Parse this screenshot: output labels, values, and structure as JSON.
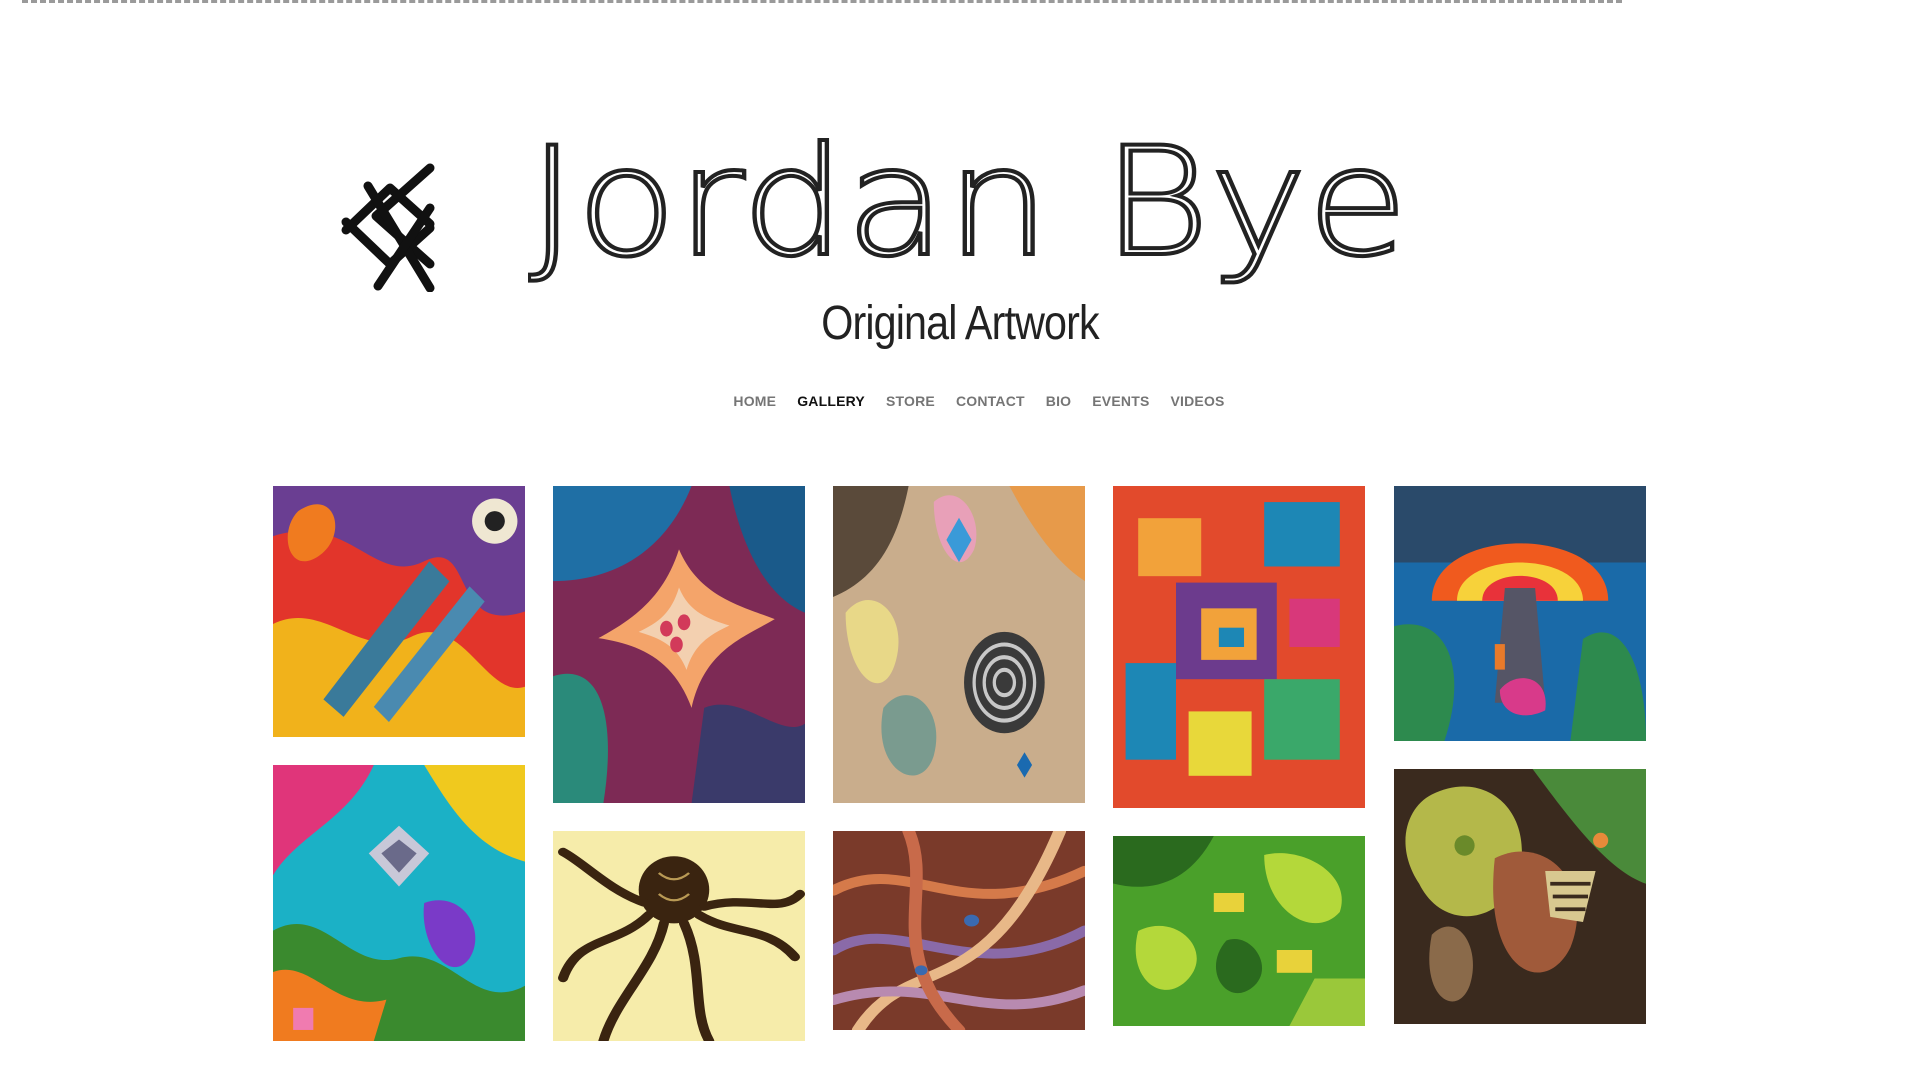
{
  "site": {
    "brand_name": "Jordan Bye",
    "tagline": "Original Artwork"
  },
  "nav": {
    "items": [
      {
        "label": "HOME",
        "active": false
      },
      {
        "label": "GALLERY",
        "active": true
      },
      {
        "label": "STORE",
        "active": false
      },
      {
        "label": "CONTACT",
        "active": false
      },
      {
        "label": "BIO",
        "active": false
      },
      {
        "label": "EVENTS",
        "active": false
      },
      {
        "label": "VIDEOS",
        "active": false
      }
    ]
  },
  "gallery": {
    "artworks": [
      {
        "icon": "abstract-warm-painting",
        "colors": [
          "#f1b21b",
          "#e2352b",
          "#6a3e92",
          "#f07b1f"
        ]
      },
      {
        "icon": "floral-abstract-painting",
        "colors": [
          "#1f6fa5",
          "#f4a46a",
          "#7d2a55",
          "#f3d0b0"
        ]
      },
      {
        "icon": "spiral-abstract-painting",
        "colors": [
          "#c9ad8c",
          "#e79a4a",
          "#3a3a3a",
          "#7a9b8f"
        ]
      },
      {
        "icon": "geometric-abstract-painting",
        "colors": [
          "#e24a2c",
          "#1d87b5",
          "#f2a23a",
          "#6c3b8d"
        ]
      },
      {
        "icon": "mushroom-abstract-painting",
        "colors": [
          "#1a6aa8",
          "#f05a1e",
          "#2d8a4e",
          "#f7d23a"
        ]
      },
      {
        "icon": "psychedelic-abstract-painting",
        "colors": [
          "#1bb1c6",
          "#f0c91e",
          "#e0357a",
          "#3a8a2e"
        ]
      },
      {
        "icon": "octopus-ink-drawing",
        "colors": [
          "#f6ecaa",
          "#3a2410",
          "#b99a55",
          "#efe08a"
        ]
      },
      {
        "icon": "tangled-abstract-painting",
        "colors": [
          "#7a3a2a",
          "#d57a4a",
          "#8a6aa8",
          "#e8b888"
        ]
      },
      {
        "icon": "green-abstract-painting",
        "colors": [
          "#4aa02a",
          "#b4d83a",
          "#2a6a1e",
          "#e8d23a"
        ]
      },
      {
        "icon": "organic-abstract-painting",
        "colors": [
          "#3a2a1e",
          "#b4b84a",
          "#a05a3a",
          "#d8c890"
        ]
      }
    ]
  }
}
